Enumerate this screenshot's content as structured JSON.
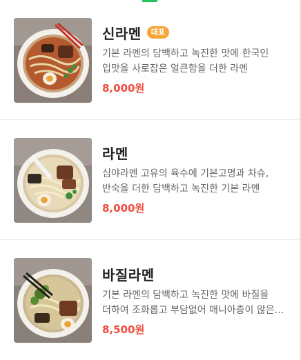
{
  "colors": {
    "accent_green": "#20c65c",
    "badge_bg": "#f6a637",
    "price": "#f24b3f",
    "title": "#222222",
    "description": "#666666"
  },
  "menu": {
    "items": [
      {
        "name": "신라멘",
        "badge": "대표",
        "description": "기본 라멘의 담백하고 녹진한 맛에 한국인 입맛을 사로잡은 얼큰함을 더한 라멘",
        "price": "8,000원",
        "image_icon": "ramen-photo"
      },
      {
        "name": "라멘",
        "description": "심야라멘 고유의 육수에 기본고명과 차슈, 반숙을 더한 담백하고 녹진한 기본 라멘",
        "price": "8,000원",
        "image_icon": "ramen-photo"
      },
      {
        "name": "바질라멘",
        "description": "기본 라멘의 담백하고 녹진한 맛에 바질을 더하여 조화롭고 부담없어 매니아층이 많은 라멘",
        "price": "8,500원",
        "image_icon": "ramen-photo"
      }
    ]
  }
}
